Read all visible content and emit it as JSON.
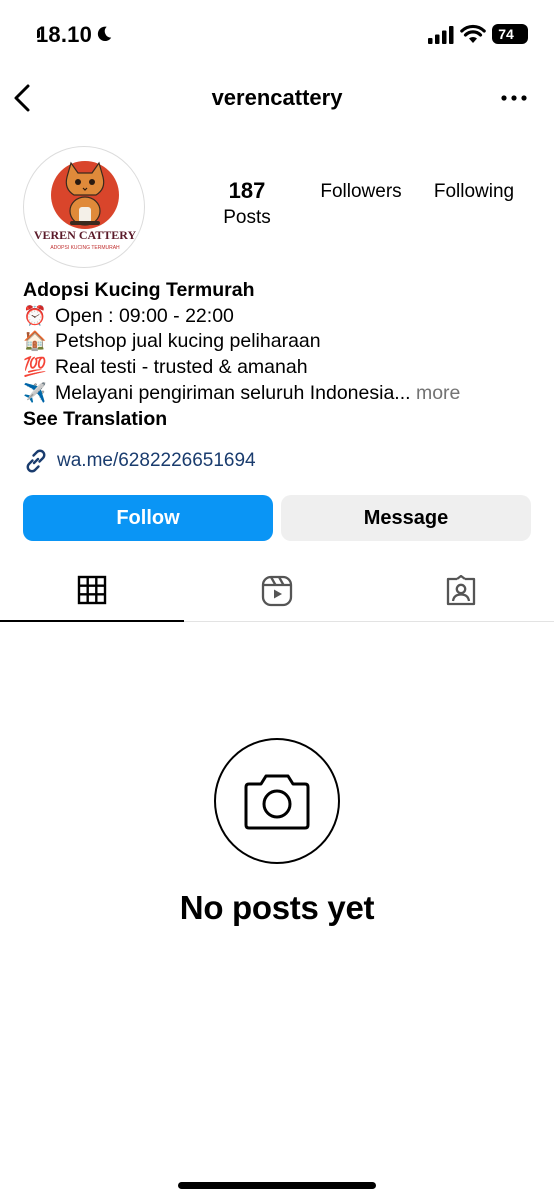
{
  "status_bar": {
    "time": "18.10",
    "battery": "74"
  },
  "nav": {
    "username": "verencattery"
  },
  "profile": {
    "avatar_text": "VEREN CATTERY",
    "avatar_subtext": "ADOPSI KUCING TERMURAH",
    "posts_count": "187",
    "posts_label": "Posts",
    "followers_label": "Followers",
    "following_label": "Following"
  },
  "bio": {
    "name": "Adopsi Kucing Termurah",
    "lines": [
      {
        "emoji": "⏰",
        "text": "Open : 09:00 - 22:00"
      },
      {
        "emoji": "🏠",
        "text": "Petshop jual kucing peliharaan"
      },
      {
        "emoji": "💯",
        "text": "Real testi - trusted & amanah"
      },
      {
        "emoji": "✈️",
        "text": "Melayani pengiriman seluruh Indonesia..."
      }
    ],
    "more": "more",
    "see_translation": "See Translation",
    "link": "wa.me/6282226651694"
  },
  "buttons": {
    "follow": "Follow",
    "message": "Message"
  },
  "tabs": [
    "grid-icon",
    "reels-icon",
    "tagged-icon"
  ],
  "empty_state": {
    "text": "No posts yet"
  },
  "colors": {
    "follow_button": "#0a95f5",
    "message_button": "#efefef",
    "link": "#1a3c6e",
    "avatar_accent": "#d9452b"
  }
}
